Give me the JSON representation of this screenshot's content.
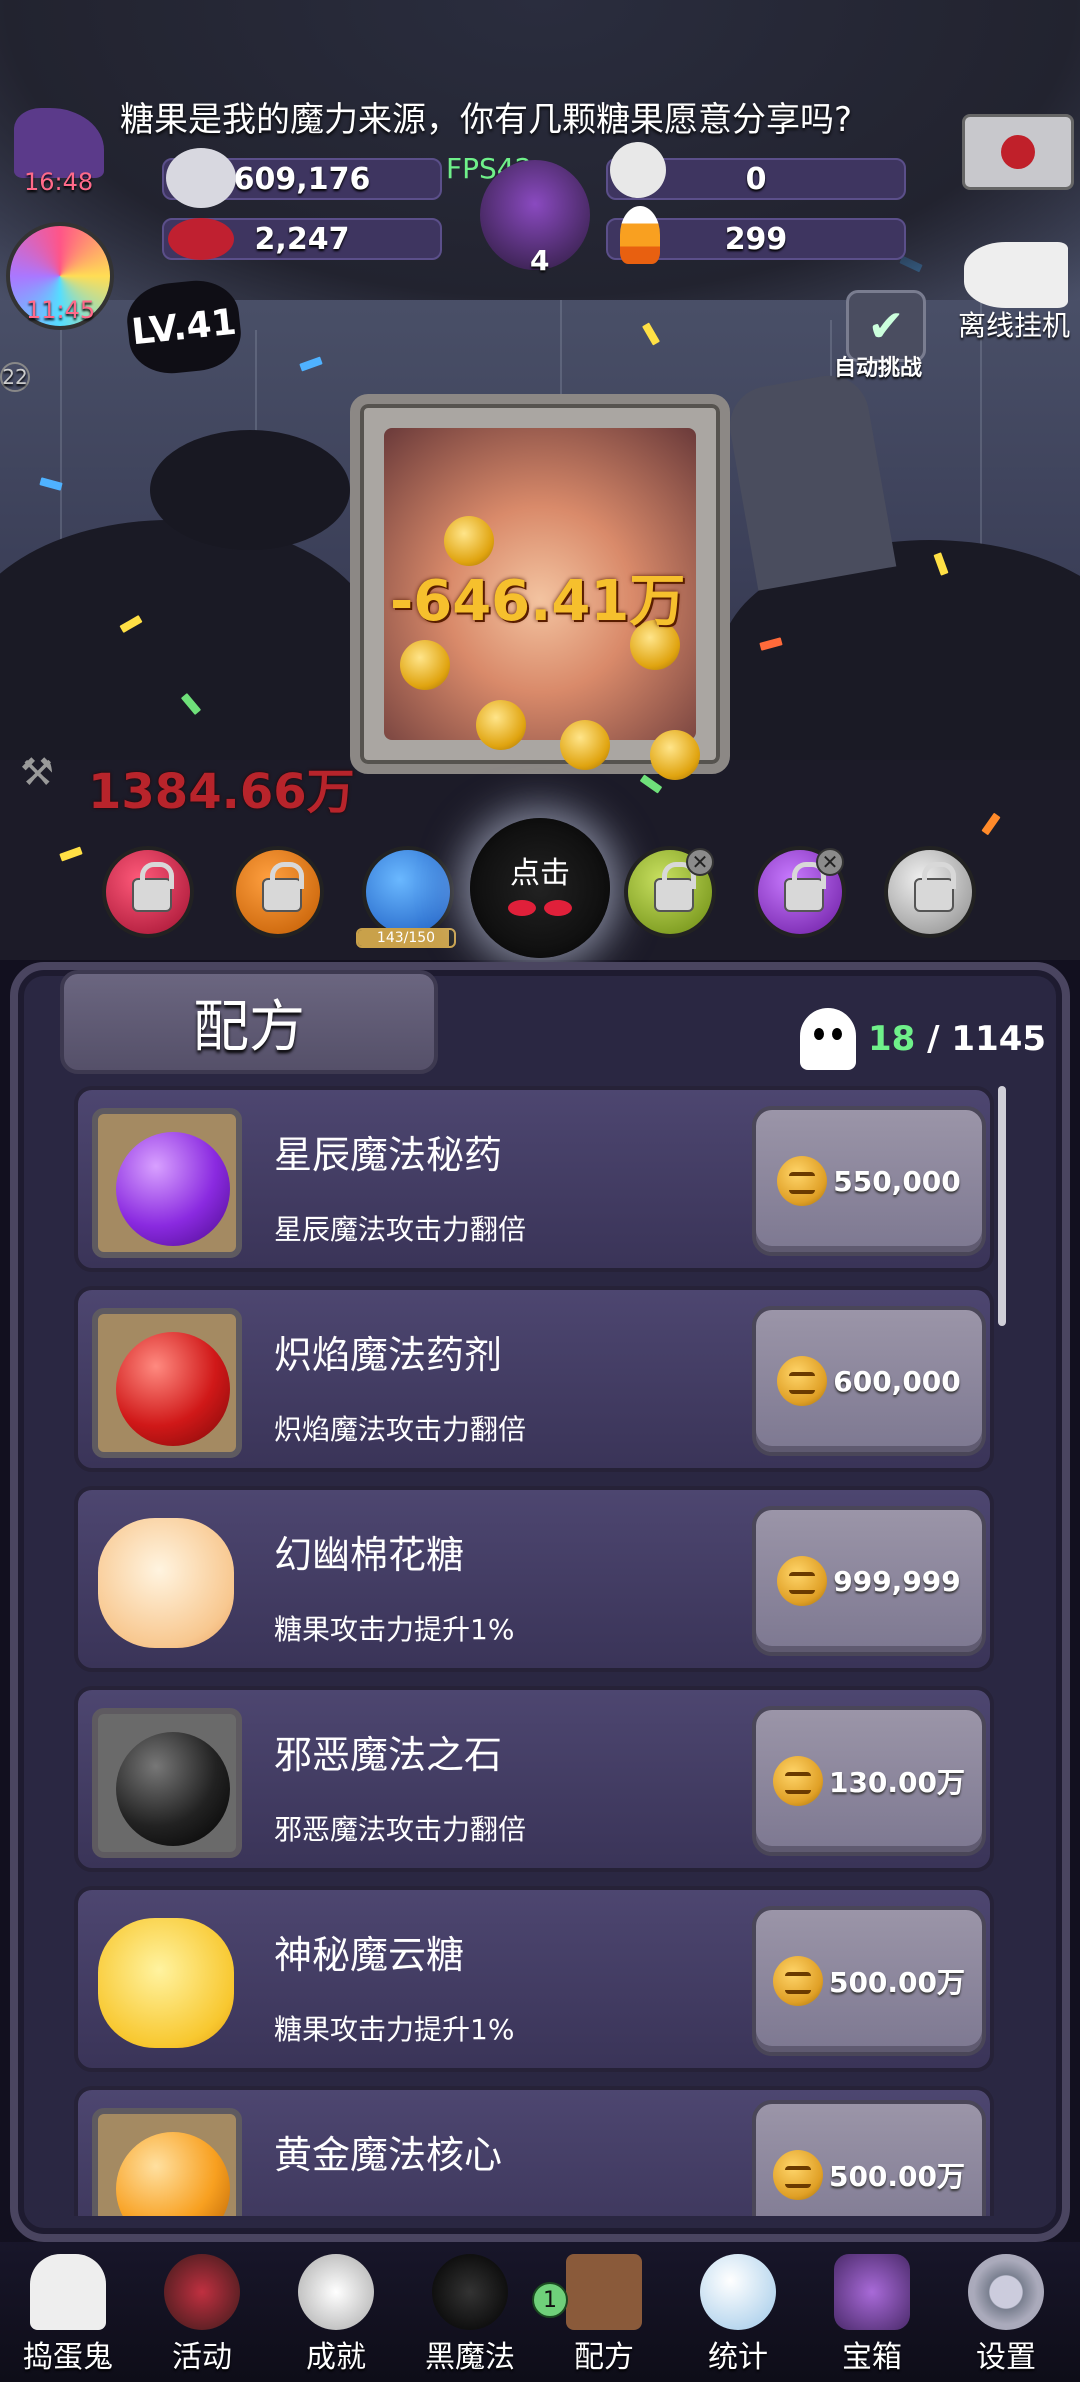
{
  "header": {
    "speech": "糖果是我的魔力来源，你有几颗糖果愿意分享吗?",
    "fps": "FPS42",
    "stats": {
      "gold": "609,176",
      "skull_count": "0",
      "candy_bag": "2,247",
      "cauldron": "4",
      "candy_corn": "299"
    },
    "timer_top": "16:48",
    "timer_left": "11:45",
    "level": "LV.41",
    "auto_challenge": "自动挑战",
    "offline_idle": "离线挂机"
  },
  "battle": {
    "damage_main": "-646.41万",
    "damage_side": "1384.66万",
    "tap_label": "点击",
    "progress_label": "143/150",
    "progress_value": 0.953,
    "side_marker": "22"
  },
  "panel": {
    "title": "配方",
    "unlocked": "18",
    "total": "/ 1145",
    "items": [
      {
        "name": "星辰魔法秘药",
        "desc": "星辰魔法攻击力翻倍",
        "price": "550,000"
      },
      {
        "name": "炽焰魔法药剂",
        "desc": "炽焰魔法攻击力翻倍",
        "price": "600,000"
      },
      {
        "name": "幻幽棉花糖",
        "desc": "糖果攻击力提升1%",
        "price": "999,999"
      },
      {
        "name": "邪恶魔法之石",
        "desc": "邪恶魔法攻击力翻倍",
        "price": "130.00万"
      },
      {
        "name": "神秘魔云糖",
        "desc": "糖果攻击力提升1%",
        "price": "500.00万"
      },
      {
        "name": "黄金魔法核心",
        "desc": "",
        "price": "500.00万"
      }
    ]
  },
  "nav": {
    "badge": "1",
    "items": [
      {
        "label": "捣蛋鬼"
      },
      {
        "label": "活动"
      },
      {
        "label": "成就"
      },
      {
        "label": "黑魔法"
      },
      {
        "label": "配方"
      },
      {
        "label": "统计"
      },
      {
        "label": "宝箱"
      },
      {
        "label": "设置"
      }
    ]
  },
  "colors": {
    "panel_bg": "#2a2742",
    "row_bg": "#4d4670",
    "buy_btn": "#9b95a8",
    "damage_gold": "#f6c02d",
    "damage_red": "#b8242b",
    "fps_green": "#6ff08a"
  }
}
